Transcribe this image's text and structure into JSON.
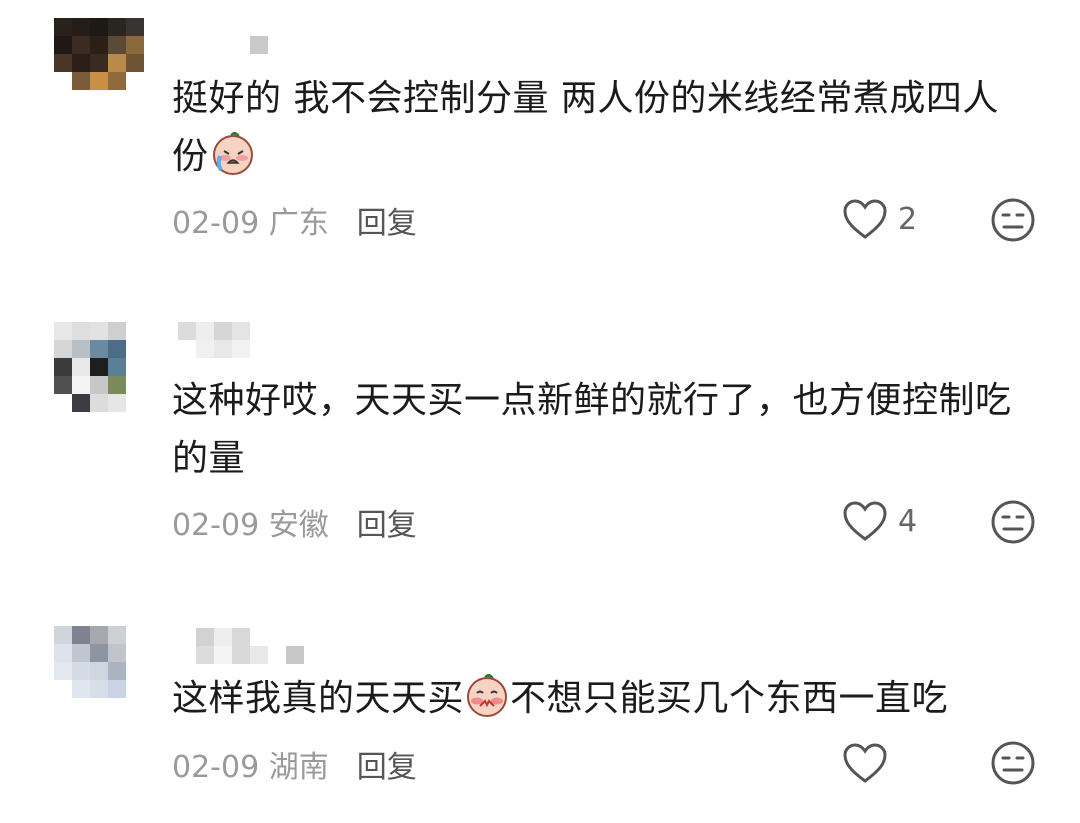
{
  "comments": [
    {
      "text_main": "挺好的 我不会控制分量 两人份的米线经常煮成四人份",
      "date": "02-09",
      "location": "广东",
      "reply_label": "回复",
      "likes": "2",
      "emoji": "crying-face-sticker"
    },
    {
      "text_main": "这种好哎，天天买一点新鲜的就行了，也方便控制吃的量",
      "date": "02-09",
      "location": "安徽",
      "reply_label": "回复",
      "likes": "4"
    },
    {
      "text_before": "这样我真的天天买",
      "text_after": "不想只能买几个东西一直吃",
      "date": "02-09",
      "location": "湖南",
      "reply_label": "回复",
      "likes": "",
      "emoji": "shy-face-sticker"
    }
  ],
  "icons": {
    "like": "heart-outline-icon",
    "react": "neutral-face-icon"
  },
  "colors": {
    "meta_gray": "#9a9a9a",
    "text": "#1b1b1b"
  }
}
